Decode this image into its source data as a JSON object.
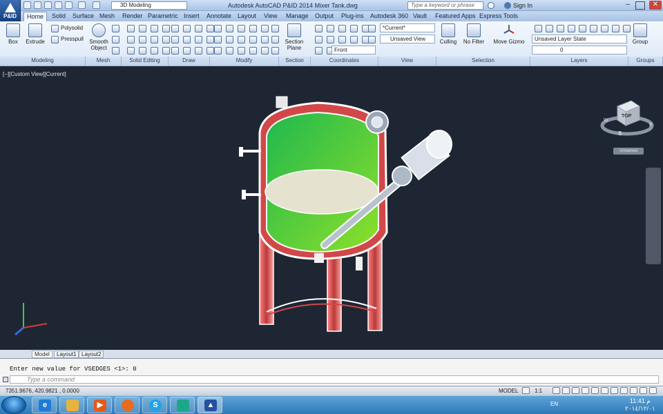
{
  "title_bar": {
    "app_logo_text": "P&ID",
    "workspace": "3D Modeling",
    "title": "Autodesk AutoCAD P&ID 2014    Mixer Tank.dwg",
    "search_placeholder": "Type a keyword or phrase",
    "sign_in": "Sign In"
  },
  "ribbon_tabs": [
    "Home",
    "Solid",
    "Surface",
    "Mesh",
    "Render",
    "Parametric",
    "Insert",
    "Annotate",
    "Layout",
    "View",
    "Manage",
    "Output",
    "Plug-ins",
    "Autodesk 360",
    "Vault",
    "Featured Apps",
    "Express Tools"
  ],
  "ribbon": {
    "modeling": {
      "box": "Box",
      "extrude": "Extrude",
      "polysolid": "Polysolid",
      "presspull": "Presspull",
      "panel": "Modeling"
    },
    "mesh": {
      "smooth": "Smooth",
      "object": "Object",
      "panel": "Mesh"
    },
    "solid_editing": {
      "panel": "Solid Editing"
    },
    "draw": {
      "panel": "Draw"
    },
    "modify": {
      "panel": "Modify"
    },
    "section": {
      "section": "Section",
      "plane": "Plane",
      "panel": "Section"
    },
    "coordinates": {
      "front": "Front",
      "panel": "Coordinates"
    },
    "view": {
      "current": "*Current*",
      "unsaved_view": "Unsaved View",
      "panel": "View"
    },
    "selection": {
      "culling": "Culling",
      "no_filter": "No Filter",
      "move_gizmo": "Move Gizmo",
      "panel": "Selection"
    },
    "layers": {
      "layer_state": "Unsaved Layer State",
      "layer_current": "0",
      "panel": "Layers"
    },
    "groups": {
      "group": "Group",
      "panel": "Groups"
    }
  },
  "viewport": {
    "label": "[−][Custom View][Current]",
    "viewcube_face": "TOP",
    "compass_w": "W",
    "compass_s": "S",
    "compass_e": "E",
    "ucs_name": "Unnamed",
    "colors": {
      "background": "#1f2633",
      "tank_fill_top": "#22c24a",
      "tank_fill_bottom": "#7be327",
      "legs": "#d24848",
      "liquid": "#e5e2d0"
    }
  },
  "layout_tabs": [
    "Model",
    "Layout1",
    "Layout2"
  ],
  "command": {
    "history": "Enter new value for VSEDGES <1>: 0",
    "placeholder": "Type a command"
  },
  "status_bar": {
    "coords": "7351.9676, 420.9821 , 0.0000",
    "model": "MODEL",
    "scale": "1:1"
  },
  "taskbar": {
    "language": "EN",
    "time": "11:41 م",
    "date": "٢٠١٤/١٢/٠١"
  }
}
